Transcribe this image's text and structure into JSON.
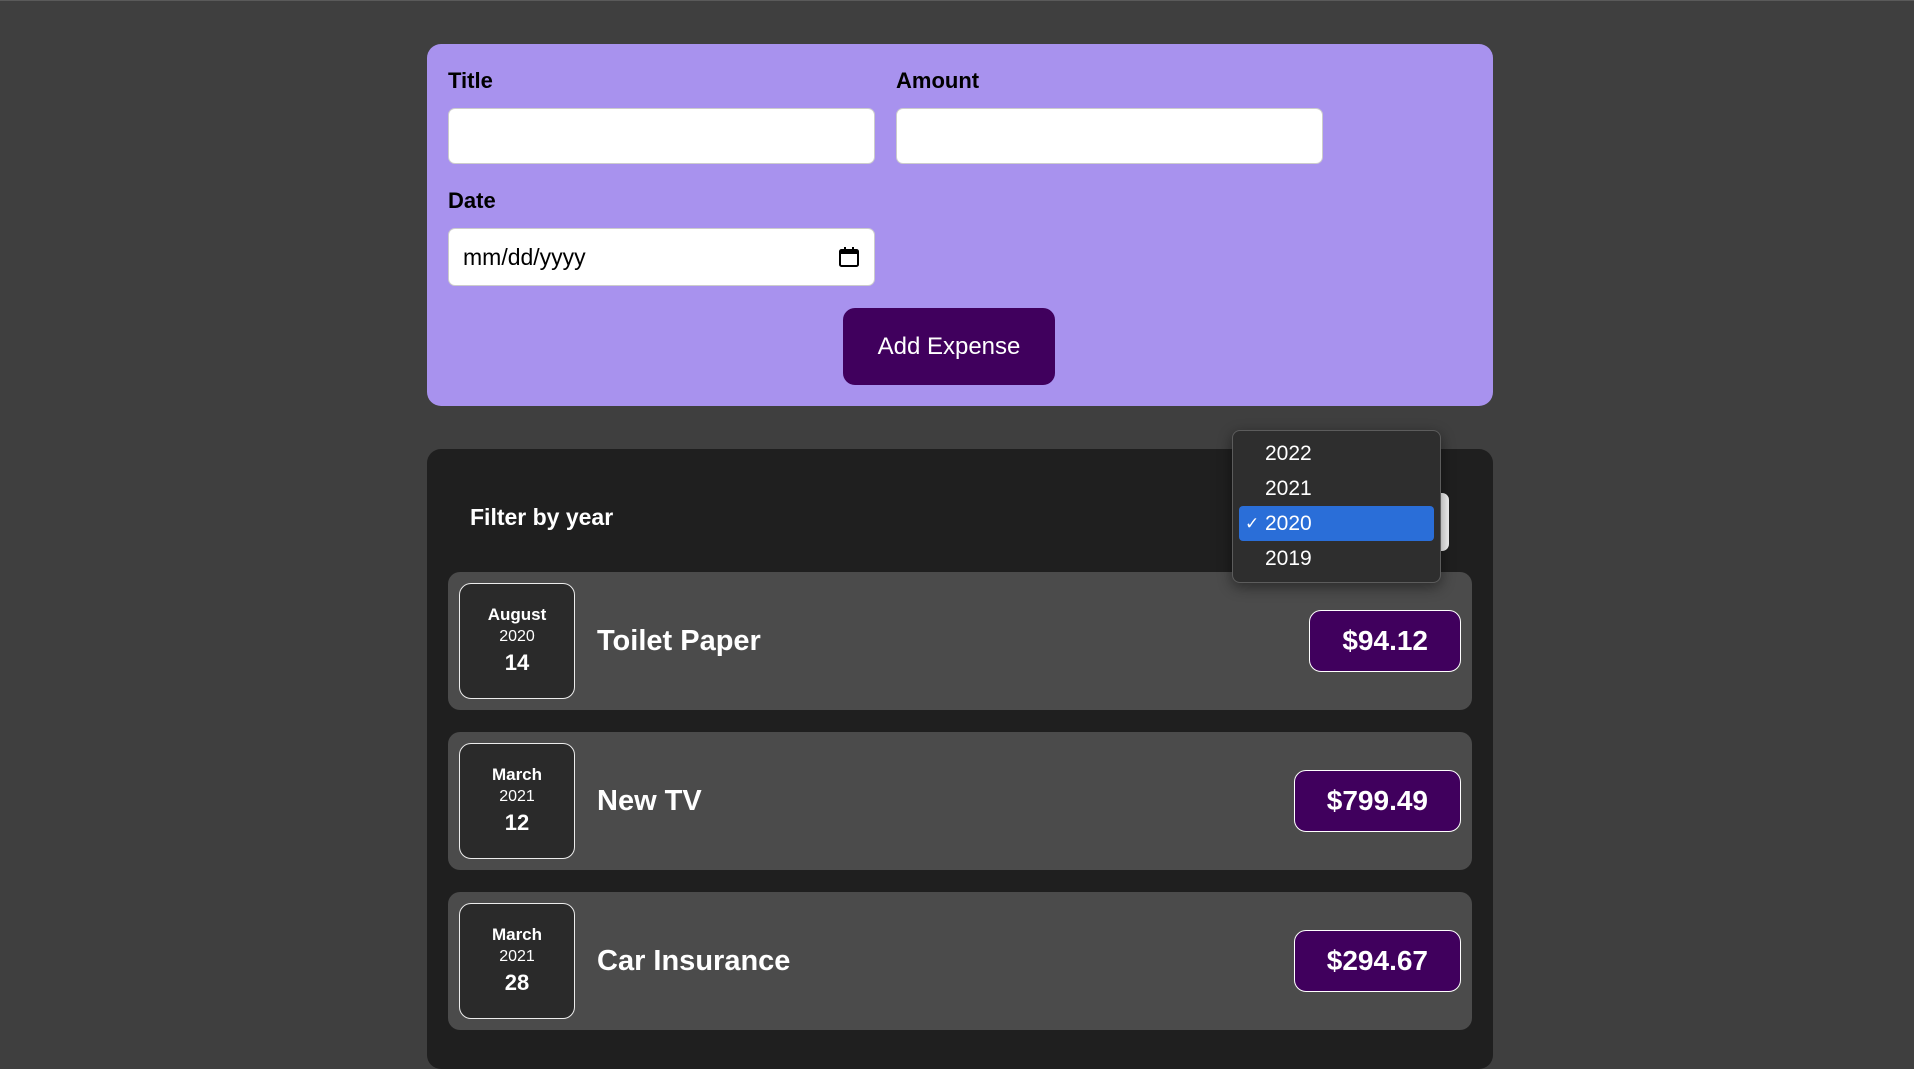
{
  "form": {
    "title_label": "Title",
    "title_value": "",
    "amount_label": "Amount",
    "amount_value": "",
    "date_label": "Date",
    "date_placeholder": "mm/dd/yyyy",
    "submit_label": "Add Expense"
  },
  "filter": {
    "label": "Filter by year",
    "options": [
      "2022",
      "2021",
      "2020",
      "2019"
    ],
    "selected": "2020",
    "checkmark": "✓"
  },
  "expenses": [
    {
      "month": "August",
      "year": "2020",
      "day": "14",
      "title": "Toilet Paper",
      "amount": "$94.12"
    },
    {
      "month": "March",
      "year": "2021",
      "day": "12",
      "title": "New TV",
      "amount": "$799.49"
    },
    {
      "month": "March",
      "year": "2021",
      "day": "28",
      "title": "Car Insurance",
      "amount": "$294.67"
    }
  ],
  "colors": {
    "page_background": "#3f3f3f",
    "form_background": "#a892ee",
    "button_background": "#40005d",
    "list_background": "#1f1f1f",
    "item_background": "#4b4b4b",
    "selected_option": "#2a6ed8"
  },
  "icons": {
    "date_picker": "calendar-icon",
    "selected_option": "checkmark-icon"
  }
}
